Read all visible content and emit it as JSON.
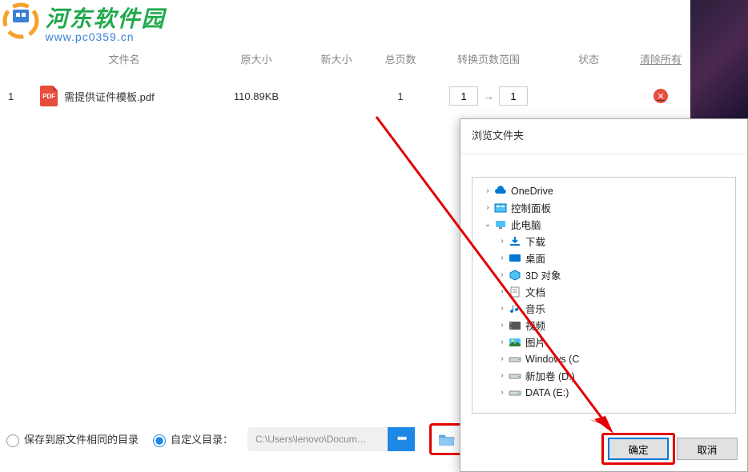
{
  "watermark": {
    "title": "河东软件园",
    "url": "www.pc0359.cn"
  },
  "headers": {
    "filename": "文件名",
    "origSize": "原大小",
    "newSize": "新大小",
    "totalPages": "总页数",
    "range": "转换页数范围",
    "status": "状态",
    "clearAll": "清除所有"
  },
  "row": {
    "index": "1",
    "iconLabel": "PDF",
    "filename": "需提供证件模板.pdf",
    "origSize": "110.89KB",
    "newSize": "",
    "totalPages": "1",
    "rangeFrom": "1",
    "rangeTo": "1",
    "deleteGlyph": "✕"
  },
  "bottom": {
    "opt1": "保存到原文件相同的目录",
    "opt2": "自定义目录：",
    "path": "C:\\Users\\lenovo\\Docum…",
    "dots": "•••"
  },
  "dialog": {
    "title": "浏览文件夹",
    "tree": [
      {
        "lvl": 1,
        "chev": "›",
        "icon": "cloud",
        "label": "OneDrive"
      },
      {
        "lvl": 1,
        "chev": "›",
        "icon": "panel",
        "label": "控制面板"
      },
      {
        "lvl": 1,
        "chev": "⌄",
        "icon": "pc",
        "label": "此电脑"
      },
      {
        "lvl": 2,
        "chev": "›",
        "icon": "download",
        "label": "下载"
      },
      {
        "lvl": 2,
        "chev": "›",
        "icon": "desktop",
        "label": "桌面"
      },
      {
        "lvl": 2,
        "chev": "›",
        "icon": "cube",
        "label": "3D 对象"
      },
      {
        "lvl": 2,
        "chev": "›",
        "icon": "doc",
        "label": "文档"
      },
      {
        "lvl": 2,
        "chev": "›",
        "icon": "music",
        "label": "音乐"
      },
      {
        "lvl": 2,
        "chev": "›",
        "icon": "video",
        "label": "视频"
      },
      {
        "lvl": 2,
        "chev": "›",
        "icon": "pic",
        "label": "图片"
      },
      {
        "lvl": 2,
        "chev": "›",
        "icon": "drive",
        "label": "Windows (C"
      },
      {
        "lvl": 2,
        "chev": "›",
        "icon": "drive",
        "label": "新加卷 (D:)"
      },
      {
        "lvl": 2,
        "chev": "›",
        "icon": "drive",
        "label": "DATA (E:)"
      }
    ],
    "ok": "确定",
    "cancel": "取消"
  }
}
